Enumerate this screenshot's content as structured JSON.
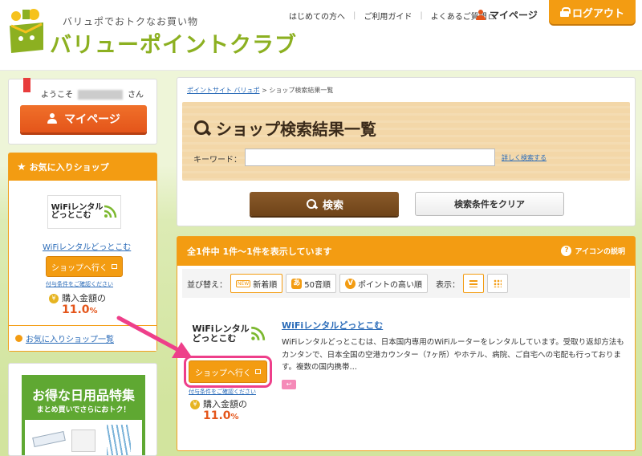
{
  "header": {
    "tagline": "バリュポでおトクなお買い物",
    "logo_text": "バリューポイントクラブ",
    "links": [
      "はじめての方へ",
      "ご利用ガイド",
      "よくあるご質問"
    ],
    "mypage": "マイページ",
    "logout": "ログアウト"
  },
  "sidebar": {
    "welcome_prefix": "ようこそ",
    "welcome_suffix": "さん",
    "mypage_button": "マイページ",
    "favorites": {
      "title": "お気に入りショップ",
      "shop_name": "WiFiレンタルどっとこむ",
      "go_button": "ショップへ行く",
      "note": "付与条件をご確認ください",
      "rate_label": "購入金額の",
      "rate_value": "11.0",
      "rate_unit": "%",
      "list_link": "お気に入りショップ一覧"
    },
    "promo": {
      "title": "お得な日用品特集",
      "subtitle": "まとめ買いでさらにおトク！"
    }
  },
  "search": {
    "breadcrumb_home": "ポイントサイト バリュポ",
    "breadcrumb_sep": ">",
    "breadcrumb_current": "ショップ検索結果一覧",
    "title": "ショップ検索結果一覧",
    "keyword_label": "キーワード：",
    "keyword_value": "",
    "advanced_link": "詳しく検索する",
    "search_button": "検索",
    "clear_button": "検索条件をクリア"
  },
  "results": {
    "summary": "全1件中 1件～1件を表示しています",
    "icon_help": "アイコンの説明",
    "sort_label": "並び替え：",
    "sort_options": [
      "新着順",
      "50音順",
      "ポイントの高い順"
    ],
    "display_label": "表示：",
    "items": [
      {
        "name": "WiFiレンタルどっとこむ",
        "description": "WiFiレンタルどっとこむは、日本国内専用のWiFiルーターをレンタルしています。受取り返却方法もカンタンで、日本全国の空港カウンター（7ヶ所）やホテル、病院、ご自宅への宅配も行っております。複数の国内携帯…",
        "go_button": "ショップへ行く",
        "note": "付与条件をご確認ください",
        "rate_label": "購入金額の",
        "rate_value": "11.0",
        "rate_unit": "%"
      }
    ]
  },
  "logos": {
    "wifi_line1": "WiFiレンタル",
    "wifi_line2": "どっとこむ"
  },
  "colors": {
    "brand_orange": "#f39c12",
    "mypage_orange": "#e4551a",
    "logo_green": "#8cb021",
    "search_brown": "#6e4318",
    "highlight_pink": "#ee3f8a"
  }
}
